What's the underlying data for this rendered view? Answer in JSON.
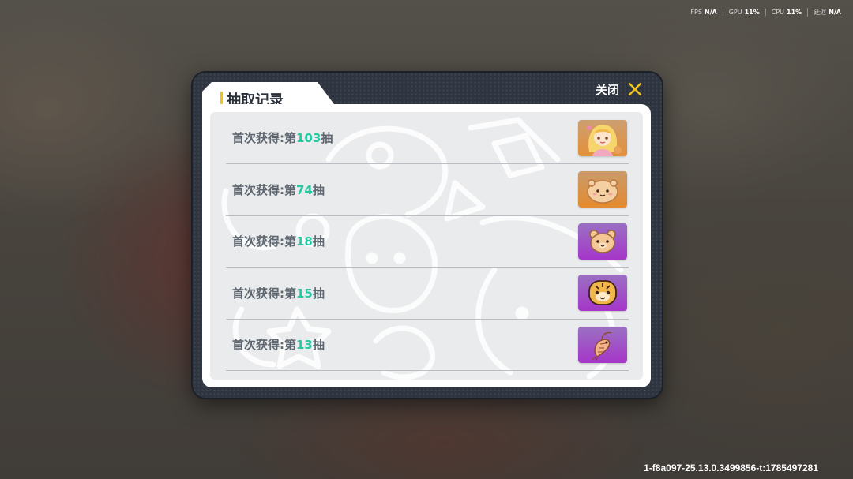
{
  "perf": {
    "fps_label": "FPS",
    "fps_value": "N/A",
    "gpu_label": "GPU",
    "gpu_value": "11%",
    "cpu_label": "CPU",
    "cpu_value": "11%",
    "latency_label": "延迟",
    "latency_value": "N/A"
  },
  "dialog": {
    "title": "抽取记录",
    "close_label": "关闭"
  },
  "records": [
    {
      "prefix": "首次获得:第",
      "count": "103",
      "suffix": "抽",
      "rarity": "orange",
      "icon": "girl-character-icon"
    },
    {
      "prefix": "首次获得:第",
      "count": "74",
      "suffix": "抽",
      "rarity": "orange",
      "icon": "bear-bun-icon"
    },
    {
      "prefix": "首次获得:第",
      "count": "18",
      "suffix": "抽",
      "rarity": "purple",
      "icon": "bear-face-icon"
    },
    {
      "prefix": "首次获得:第",
      "count": "15",
      "suffix": "抽",
      "rarity": "purple",
      "icon": "tiger-face-icon"
    },
    {
      "prefix": "首次获得:第",
      "count": "13",
      "suffix": "抽",
      "rarity": "purple",
      "icon": "shrimp-icon"
    }
  ],
  "colors": {
    "accent": "#f2c21c",
    "count_highlight": "#25c9a1",
    "rarity_orange": "#e48b2f",
    "rarity_purple": "#a536c9"
  },
  "build_id": "1-f8a097-25.13.0.3499856-t:1785497281"
}
